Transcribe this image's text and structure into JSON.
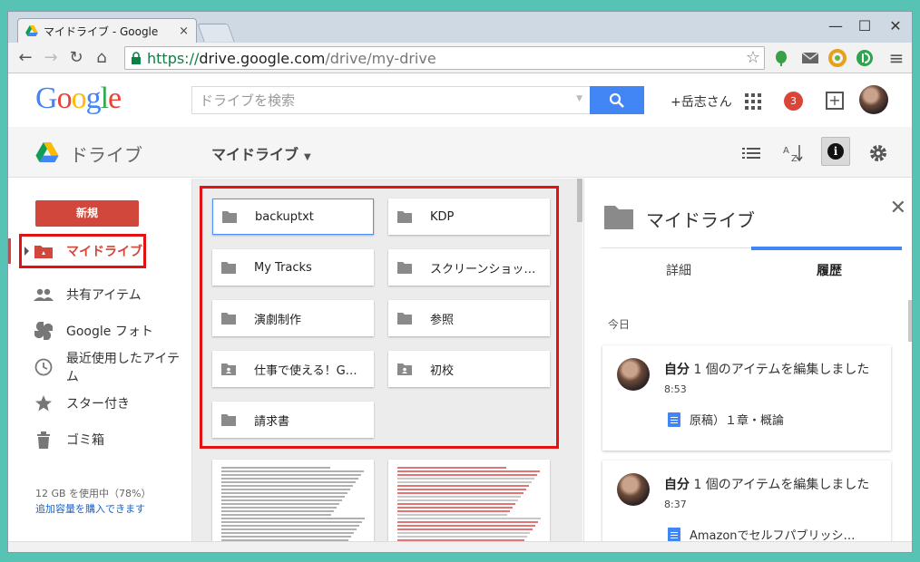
{
  "browser": {
    "tab_title": "マイドライブ - Google",
    "tab_close": "×",
    "url_scheme": "https://",
    "url_host": "drive.google.com",
    "url_path": "/drive/my-drive",
    "controls": {
      "minimize": "—",
      "maximize": "☐",
      "close": "✕"
    }
  },
  "header": {
    "logo": [
      "G",
      "o",
      "o",
      "g",
      "l",
      "e"
    ],
    "logo_colors": [
      "#4285f4",
      "#ea4335",
      "#fbbc05",
      "#4285f4",
      "#34a853",
      "#ea4335"
    ],
    "search_placeholder": "ドライブを検索",
    "user_name": "+岳志さん",
    "notification_count": "3"
  },
  "drivebar": {
    "product": "ドライブ",
    "location": "マイドライブ"
  },
  "sidebar": {
    "new_button": "新規",
    "items": [
      {
        "label": "マイドライブ",
        "icon": "drive-icon",
        "active": true
      },
      {
        "label": "共有アイテム",
        "icon": "people-icon"
      },
      {
        "label": "Google フォト",
        "icon": "photos-icon"
      },
      {
        "label": "最近使用したアイテム",
        "icon": "clock-icon"
      },
      {
        "label": "スター付き",
        "icon": "star-icon"
      },
      {
        "label": "ゴミ箱",
        "icon": "trash-icon"
      }
    ],
    "storage_usage": "12 GB を使用中（78%）",
    "buy_storage": "追加容量を購入できます"
  },
  "folders": [
    {
      "name": "backuptxt",
      "type": "folder",
      "selected": true
    },
    {
      "name": "KDP",
      "type": "folder"
    },
    {
      "name": "My Tracks",
      "type": "folder"
    },
    {
      "name": "スクリーンショッ…",
      "type": "folder"
    },
    {
      "name": "演劇制作",
      "type": "folder"
    },
    {
      "name": "参照",
      "type": "folder"
    },
    {
      "name": "仕事で使える！G…",
      "type": "shared-folder"
    },
    {
      "name": "初校",
      "type": "shared-folder"
    },
    {
      "name": "請求書",
      "type": "folder"
    }
  ],
  "details": {
    "title": "マイドライブ",
    "tabs": [
      "詳細",
      "履歴"
    ],
    "active_tab": "履歴",
    "section": "今日",
    "activities": [
      {
        "actor": "自分",
        "action": " 1 個のアイテムを編集しました",
        "time": "8:53",
        "file": "原稿）１章・概論"
      },
      {
        "actor": "自分",
        "action": " 1 個のアイテムを編集しました",
        "time": "8:37",
        "file": "Amazonでセルフパブリッシ…"
      }
    ]
  },
  "colors": {
    "accent_red": "#d1473c",
    "google_blue": "#4285f4",
    "annotation_red": "#e31111"
  }
}
